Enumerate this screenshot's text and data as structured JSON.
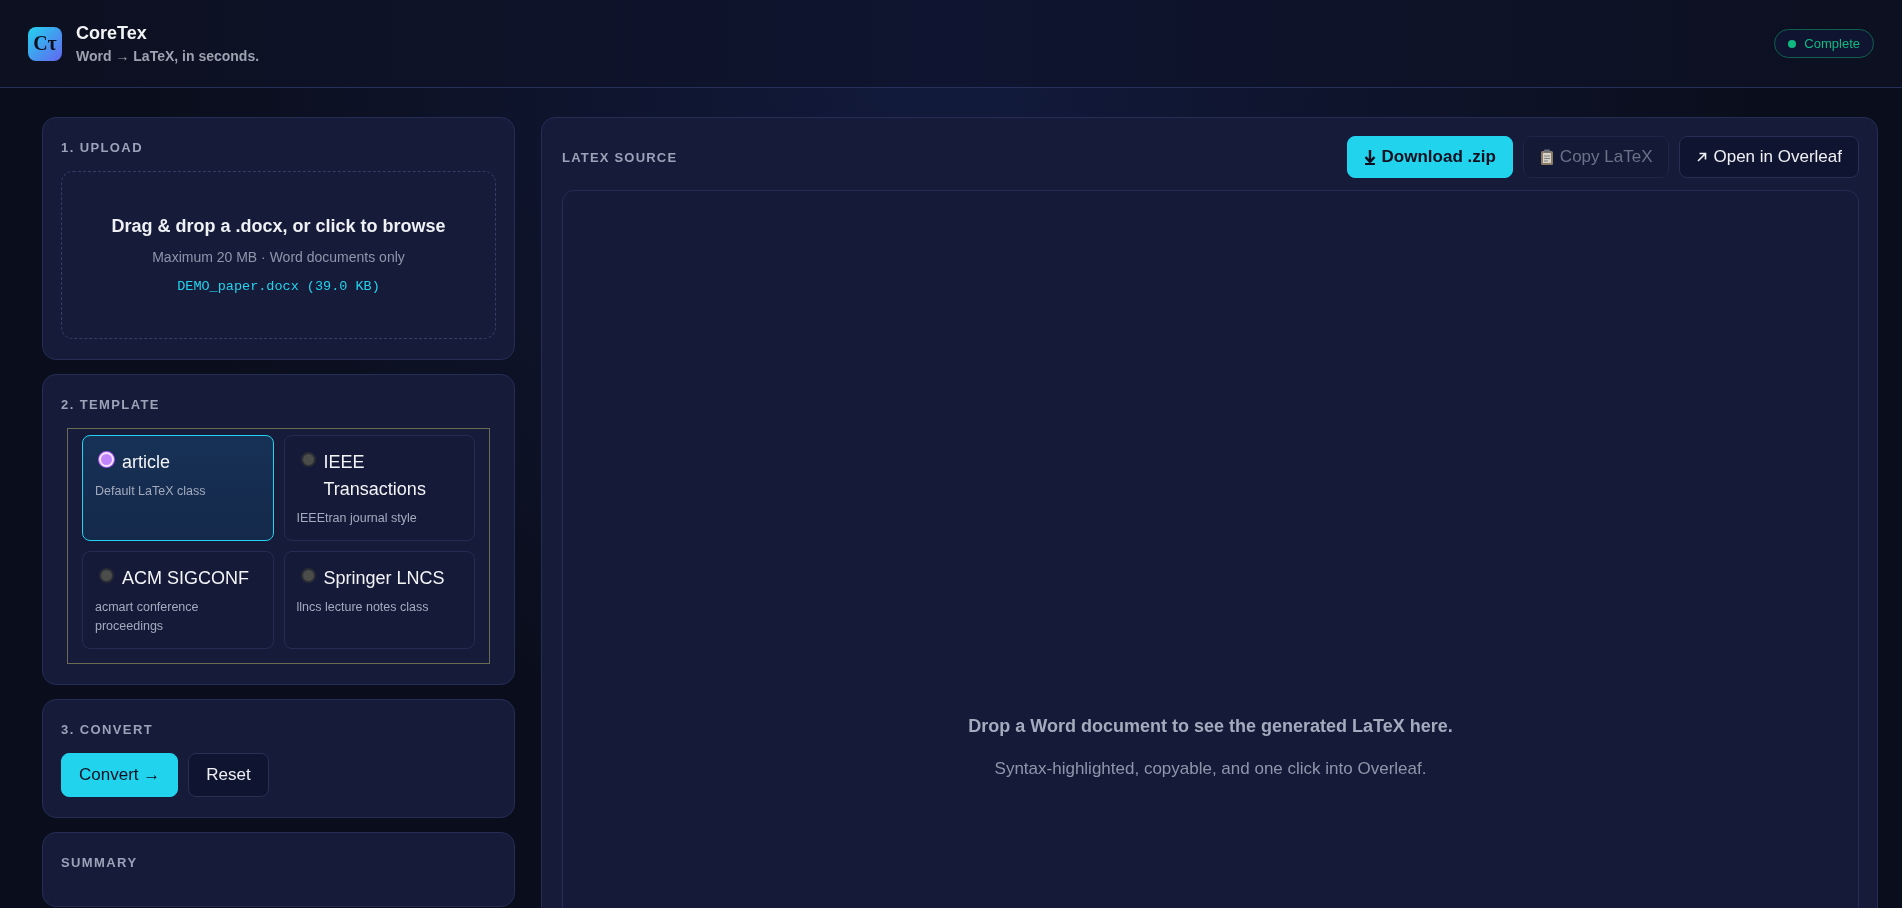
{
  "header": {
    "logo": "Cτ",
    "title": "CoreTex",
    "tagline": "Word → LaTeX, in seconds.",
    "status": {
      "label": "Complete"
    }
  },
  "upload": {
    "heading": "1. UPLOAD",
    "prompt": "Drag & drop a .docx, or click to browse",
    "hint": "Maximum 20 MB · Word documents only",
    "file": "DEMO_paper.docx (39.0 KB)"
  },
  "template": {
    "heading": "2. TEMPLATE",
    "options": [
      {
        "name": "article",
        "description": "Default LaTeX class",
        "selected": true
      },
      {
        "name": "IEEE Transactions",
        "description": "IEEEtran journal style",
        "selected": false
      },
      {
        "name": "ACM SIGCONF",
        "description": "acmart conference proceedings",
        "selected": false
      },
      {
        "name": "Springer LNCS",
        "description": "llncs lecture notes class",
        "selected": false
      }
    ]
  },
  "convert": {
    "heading": "3. CONVERT",
    "buttons": [
      {
        "label": "Convert →",
        "kind": "primary"
      },
      {
        "label": "Reset",
        "kind": "secondary"
      }
    ]
  },
  "summary": {
    "heading": "SUMMARY"
  },
  "latex": {
    "heading": "LATEX SOURCE",
    "actions": [
      {
        "label": "Download .zip",
        "kind": "download",
        "disabled": false
      },
      {
        "label": "Copy LaTeX",
        "kind": "copy",
        "disabled": true
      },
      {
        "label": "Open in Overleaf",
        "kind": "open",
        "disabled": false
      }
    ],
    "empty_title": "Drop a Word document to see the generated LaTeX here.",
    "empty_hint": "Syntax-highlighted, copyable, and one click into Overleaf."
  }
}
